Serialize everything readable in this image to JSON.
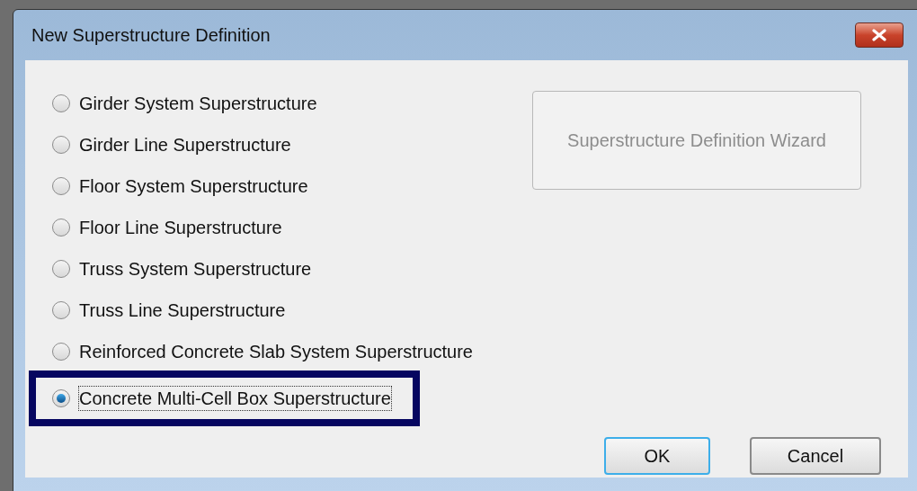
{
  "window": {
    "title": "New Superstructure Definition"
  },
  "options": [
    {
      "label": "Girder System Superstructure",
      "selected": false
    },
    {
      "label": "Girder Line Superstructure",
      "selected": false
    },
    {
      "label": "Floor System Superstructure",
      "selected": false
    },
    {
      "label": "Floor Line Superstructure",
      "selected": false
    },
    {
      "label": "Truss System Superstructure",
      "selected": false
    },
    {
      "label": "Truss Line Superstructure",
      "selected": false
    },
    {
      "label": "Reinforced Concrete Slab System Superstructure",
      "selected": false
    },
    {
      "label": "Concrete Multi-Cell Box Superstructure",
      "selected": true
    }
  ],
  "wizard_button": {
    "label": "Superstructure Definition Wizard",
    "disabled": true
  },
  "buttons": [
    {
      "label": "OK",
      "kind": "default"
    },
    {
      "label": "Cancel",
      "kind": "normal"
    }
  ]
}
